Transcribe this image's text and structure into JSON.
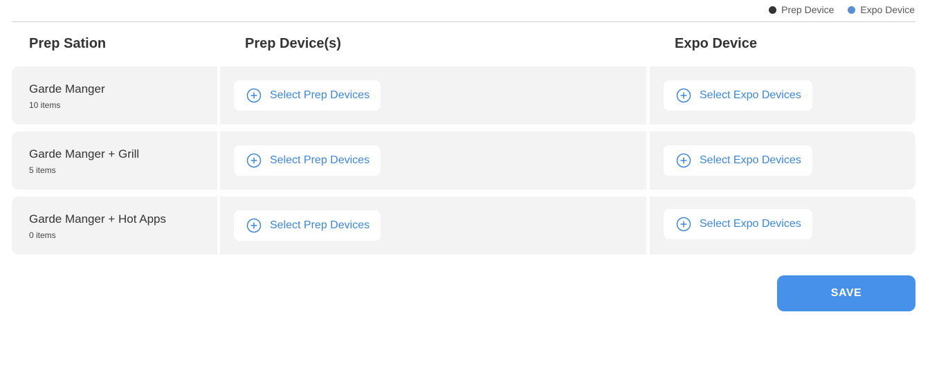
{
  "legend": {
    "items": [
      {
        "label": "Prep Device",
        "color": "#333333"
      },
      {
        "label": "Expo Device",
        "color": "#5b8fd1"
      }
    ]
  },
  "table": {
    "headers": {
      "station": "Prep Sation",
      "prep": "Prep Device(s)",
      "expo": "Expo Device"
    },
    "rows": [
      {
        "name": "Garde Manger",
        "count": "10 items",
        "prep_button": "Select Prep Devices",
        "expo_button": "Select Expo Devices"
      },
      {
        "name": "Garde Manger + Grill",
        "count": "5 items",
        "prep_button": "Select Prep Devices",
        "expo_button": "Select Expo Devices"
      },
      {
        "name": "Garde Manger + Hot Apps",
        "count": "0 items",
        "prep_button": "Select Prep Devices",
        "expo_button": "Select Expo Devices"
      }
    ]
  },
  "actions": {
    "save_label": "SAVE"
  },
  "colors": {
    "accent": "#4891ea",
    "link": "#3d87d9",
    "row_bg": "#f3f3f3"
  },
  "icons": {
    "add": "plus-circle-icon"
  }
}
